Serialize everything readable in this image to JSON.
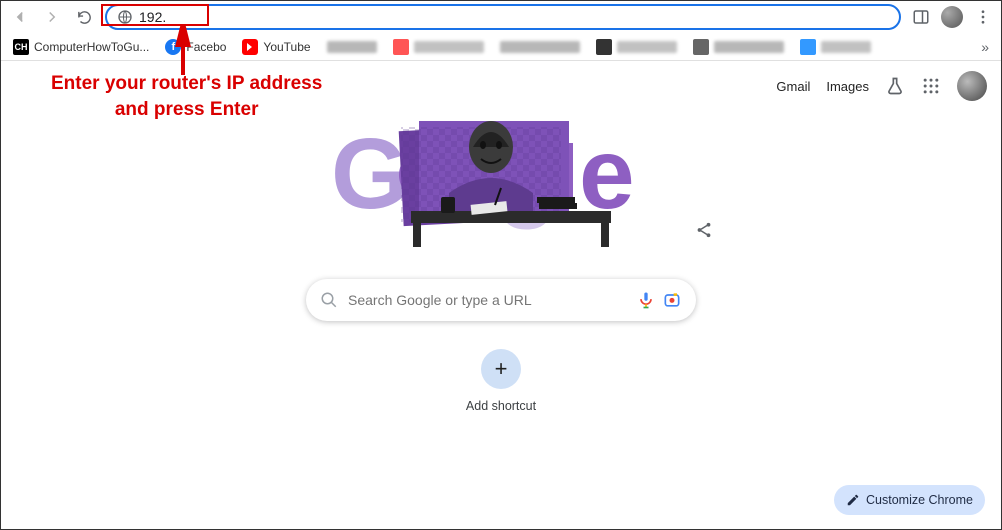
{
  "toolbar": {
    "omnibox_value": "192."
  },
  "bookmarks": {
    "items": [
      {
        "label": "ComputerHowToGu...",
        "icon_bg": "#000",
        "icon_text_color": "#fff"
      },
      {
        "label": "Facebo",
        "icon_bg": "#1877f2"
      },
      {
        "label": "YouTube",
        "icon_bg": "#ff0000"
      }
    ]
  },
  "annotation": {
    "line1": "Enter your router's IP address",
    "line2": "and press Enter"
  },
  "header": {
    "gmail": "Gmail",
    "images": "Images"
  },
  "search": {
    "placeholder": "Search Google or type a URL"
  },
  "shortcut": {
    "label": "Add shortcut"
  },
  "customize": {
    "label": "Customize Chrome"
  }
}
